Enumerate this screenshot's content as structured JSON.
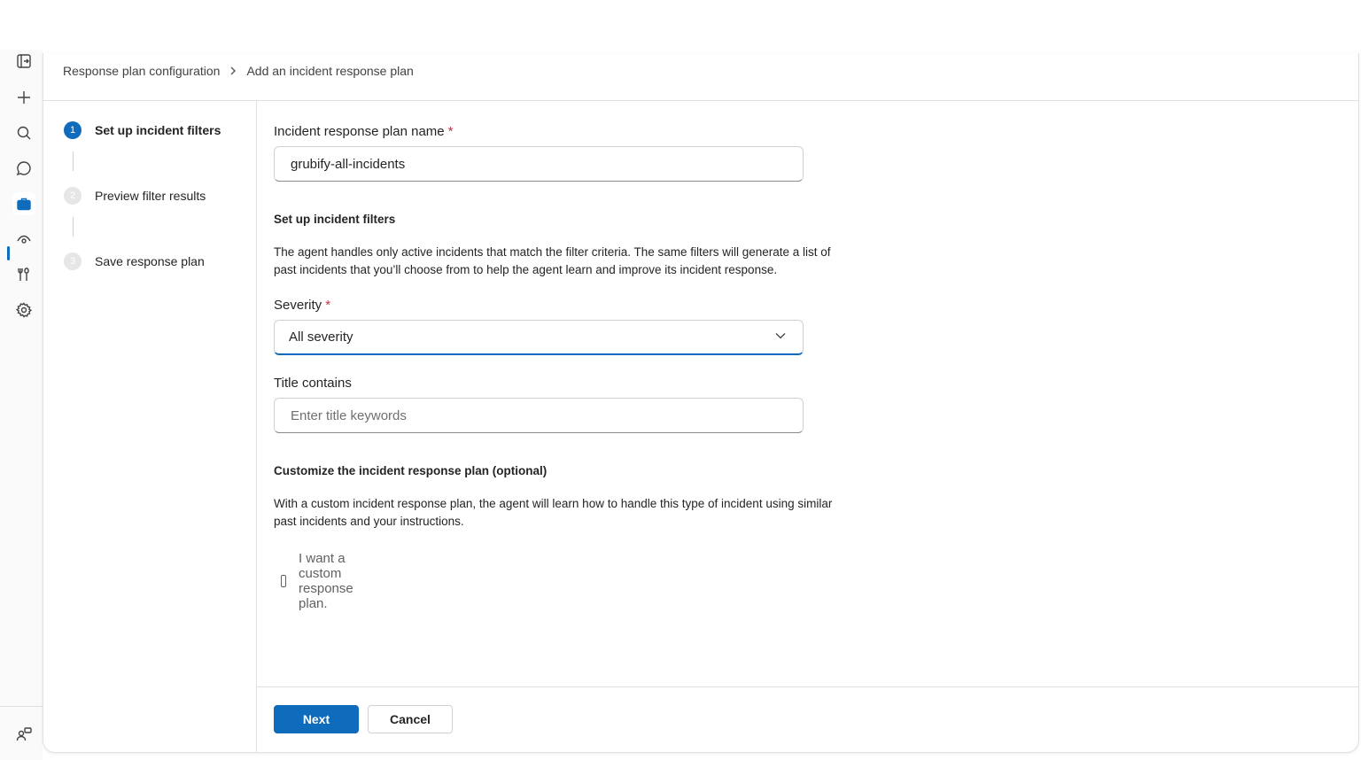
{
  "rail": {
    "icons": [
      "expand-panel-icon",
      "plus-icon",
      "search-icon",
      "chat-icon",
      "briefcase-icon",
      "eye-icon",
      "tools-icon",
      "settings-icon",
      "people-icon"
    ],
    "accent_color": "#0f6cbd"
  },
  "breadcrumb": {
    "parent": "Response plan configuration",
    "current": "Add an incident response plan"
  },
  "steps": [
    {
      "number": "1",
      "label": "Set up incident filters",
      "state": "current"
    },
    {
      "number": "2",
      "label": "Preview filter results",
      "state": "pending"
    },
    {
      "number": "3",
      "label": "Save response plan",
      "state": "pending"
    }
  ],
  "form": {
    "name_label": "Incident response plan name",
    "required_mark": "*",
    "name_value": "grubify-all-incidents",
    "filters_title": "Set up incident filters",
    "filters_desc": "The agent handles only active incidents that match the filter criteria. The same filters will generate a list of past incidents that you’ll choose from to help the agent learn and improve its incident response.",
    "severity_label": "Severity",
    "severity_value": "All severity",
    "title_label": "Title contains",
    "title_placeholder": "Enter title keywords",
    "custom_title": "Customize the incident response plan (optional)",
    "custom_desc": "With a custom incident response plan, the agent will learn how to handle this type of incident using similar past incidents and your instructions.",
    "checkbox_label": "I want a custom response plan.",
    "checkbox_checked": false
  },
  "footer": {
    "next_label": "Next",
    "cancel_label": "Cancel"
  }
}
